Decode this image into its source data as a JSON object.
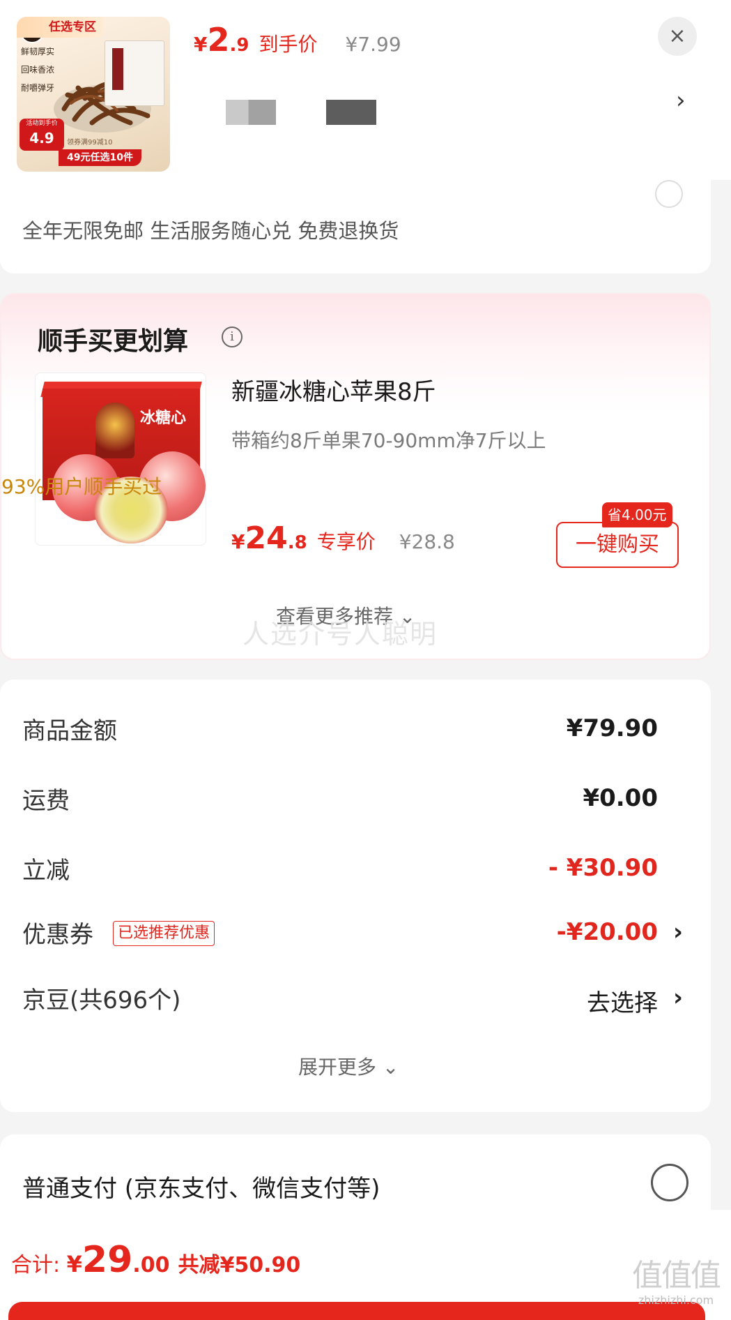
{
  "popup": {
    "thumb": {
      "tag": "任选专区",
      "logo": "磨",
      "features": [
        "鲜韧厚实",
        "回味香浓",
        "耐嚼弹牙"
      ],
      "badge_small": "活动到手价",
      "badge_price": "4.9",
      "coupon_note": "领券满99减10",
      "bar_text": "49元任选10件"
    },
    "price_symbol": "¥",
    "price_int": "2",
    "price_dec": ".9",
    "price_tag": "到手价",
    "original_price": "¥7.99",
    "close_icon": "×",
    "arrow_icon": "›"
  },
  "card_top": {
    "benefits": "全年无限免邮 生活服务随心兑 免费退换货"
  },
  "recommend": {
    "title": "顺手买更划算",
    "info_icon": "i",
    "product": {
      "box_word": "冰糖心",
      "name": "新疆冰糖心苹果8斤",
      "desc": "带箱约8斤单果70-90mm净7斤以上",
      "social_proof": "93%用户顺手买过",
      "price_symbol": "¥",
      "price_int": "24",
      "price_dec": ".8",
      "price_tag": "专享价",
      "original_price": "¥28.8",
      "save_badge": "省4.00元",
      "buy_label": "一键购买"
    },
    "more_label": "查看更多推荐 ⌄",
    "watermark": "人选介号人聪明"
  },
  "summary": {
    "rows": [
      {
        "label": "商品金额",
        "value": "¥79.90"
      },
      {
        "label": "运费",
        "value": "¥0.00"
      },
      {
        "label": "立减",
        "value": "- ¥30.90"
      },
      {
        "label": "优惠券",
        "tag": "已选推荐优惠",
        "value": "-¥20.00"
      },
      {
        "label": "京豆(共696个)",
        "value": "去选择"
      }
    ],
    "chevron": "›",
    "expand_label": "展开更多 ⌄"
  },
  "payment": {
    "label": "普通支付 (京东支付、微信支付等)"
  },
  "bottom": {
    "total_label": "合计: ",
    "total_symbol": "¥",
    "total_int": "29",
    "total_dec": ".00",
    "saved": "共减¥50.90",
    "site_logo": "值值值",
    "site_url": "zhizhizhi.com"
  },
  "colors": {
    "accent_red": "#e4261d",
    "social_proof_orange": "#c8860a"
  }
}
